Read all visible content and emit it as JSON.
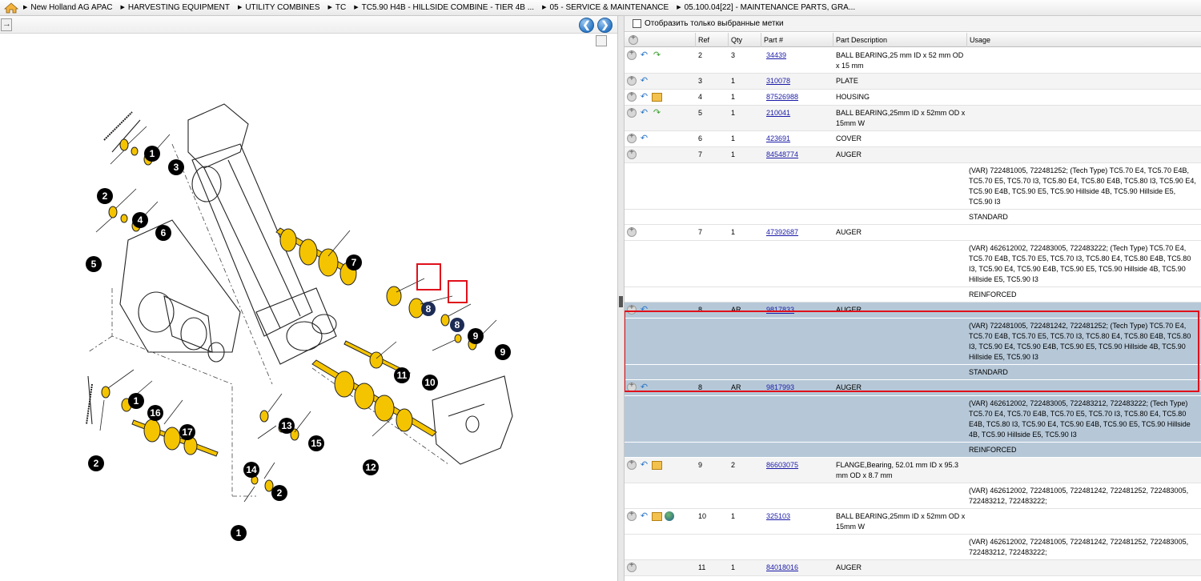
{
  "breadcrumb": [
    "New Holland AG APAC",
    "HARVESTING EQUIPMENT",
    "UTILITY COMBINES",
    "TC",
    "TC5.90 H4B - HILLSIDE COMBINE - TIER 4B ...",
    "05 - SERVICE & MAINTENANCE",
    "05.100.04[22] - MAINTENANCE PARTS, GRA..."
  ],
  "filter_label": "Отобразить только выбранные метки",
  "columns": {
    "ref": "Ref",
    "qty": "Qty",
    "part": "Part #",
    "desc": "Part Description",
    "usage": "Usage"
  },
  "icons": {
    "home": "home-icon",
    "back": "arrow-back-icon",
    "forward": "arrow-forward-icon",
    "box": "package-icon",
    "globe": "globe-icon",
    "expand": "plus-circle-icon"
  },
  "colors": {
    "selected_row": "#b6c8d8",
    "highlight": "#e0101a",
    "link": "#1a1aa8",
    "part_yellow": "#f5c400"
  },
  "rows": [
    {
      "ref": "2",
      "qty": "3",
      "part": "34439",
      "desc": "BALL BEARING,25 mm ID x 52 mm OD x 15 mm",
      "icons": [
        "back",
        "forward"
      ],
      "usage": "",
      "subs": []
    },
    {
      "ref": "3",
      "qty": "1",
      "part": "310078",
      "desc": "PLATE",
      "icons": [
        "back"
      ],
      "usage": "",
      "subs": []
    },
    {
      "ref": "4",
      "qty": "1",
      "part": "87526988",
      "desc": "HOUSING",
      "icons": [
        "back",
        "box"
      ],
      "usage": "",
      "subs": []
    },
    {
      "ref": "5",
      "qty": "1",
      "part": "210041",
      "desc": "BALL BEARING,25mm ID x 52mm OD x 15mm W",
      "icons": [
        "back",
        "forward"
      ],
      "usage": "",
      "subs": []
    },
    {
      "ref": "6",
      "qty": "1",
      "part": "423691",
      "desc": "COVER",
      "icons": [
        "back"
      ],
      "usage": "",
      "subs": []
    },
    {
      "ref": "7",
      "qty": "1",
      "part": "84548774",
      "desc": "AUGER",
      "icons": [],
      "usage": "",
      "subs": [
        "(VAR) 722481005, 722481252; (Tech Type) TC5.70 E4, TC5.70 E4B, TC5.70 E5, TC5.70 I3, TC5.80 E4, TC5.80 E4B, TC5.80 I3, TC5.90 E4, TC5.90 E4B, TC5.90 E5, TC5.90 Hillside 4B, TC5.90 Hillside E5, TC5.90 I3",
        "STANDARD"
      ]
    },
    {
      "ref": "7",
      "qty": "1",
      "part": "47392687",
      "desc": "AUGER",
      "icons": [],
      "usage": "",
      "subs": [
        "(VAR) 462612002, 722483005, 722483222; (Tech Type) TC5.70 E4, TC5.70 E4B, TC5.70 E5, TC5.70 I3, TC5.80 E4, TC5.80 E4B, TC5.80 I3, TC5.90 E4, TC5.90 E4B, TC5.90 E5, TC5.90 Hillside 4B, TC5.90 Hillside E5, TC5.90 I3",
        "REINFORCED"
      ]
    },
    {
      "ref": "8",
      "qty": "AR",
      "part": "9817833",
      "desc": "AUGER",
      "icons": [
        "back"
      ],
      "usage": "",
      "selected": true,
      "subs": [
        "(VAR) 722481005, 722481242, 722481252; (Tech Type) TC5.70 E4, TC5.70 E4B, TC5.70 E5, TC5.70 I3, TC5.80 E4, TC5.80 E4B, TC5.80 I3, TC5.90 E4, TC5.90 E4B, TC5.90 E5, TC5.90 Hillside 4B, TC5.90 Hillside E5, TC5.90 I3",
        "STANDARD"
      ]
    },
    {
      "ref": "8",
      "qty": "AR",
      "part": "9817993",
      "desc": "AUGER",
      "icons": [
        "back"
      ],
      "usage": "",
      "selected": true,
      "subs": [
        "(VAR) 462612002, 722483005, 722483212, 722483222; (Tech Type) TC5.70 E4, TC5.70 E4B, TC5.70 E5, TC5.70 I3, TC5.80 E4, TC5.80 E4B, TC5.80 I3, TC5.90 E4, TC5.90 E4B, TC5.90 E5, TC5.90 Hillside 4B, TC5.90 Hillside E5, TC5.90 I3",
        "REINFORCED"
      ]
    },
    {
      "ref": "9",
      "qty": "2",
      "part": "86603075",
      "desc": "FLANGE,Bearing, 52.01 mm ID x 95.3 mm OD x 8.7 mm",
      "icons": [
        "back",
        "box"
      ],
      "usage": "",
      "subs": [
        "(VAR) 462612002, 722481005, 722481242, 722481252, 722483005, 722483212, 722483222;"
      ]
    },
    {
      "ref": "10",
      "qty": "1",
      "part": "325103",
      "desc": "BALL BEARING,25mm ID x 52mm OD x 15mm W",
      "icons": [
        "back",
        "box",
        "globe"
      ],
      "usage": "",
      "subs": [
        "(VAR) 462612002, 722481005, 722481242, 722481252, 722483005, 722483212, 722483222;"
      ]
    },
    {
      "ref": "11",
      "qty": "1",
      "part": "84018016",
      "desc": "AUGER",
      "icons": [],
      "usage": "",
      "subs": []
    }
  ],
  "diagram": {
    "callouts": [
      "1",
      "2",
      "3",
      "4",
      "5",
      "6",
      "7",
      "8",
      "8",
      "9",
      "9",
      "10",
      "11",
      "12",
      "1",
      "2",
      "16",
      "17",
      "13",
      "14",
      "15",
      "2",
      "1"
    ],
    "highlighted_callout": "8"
  }
}
